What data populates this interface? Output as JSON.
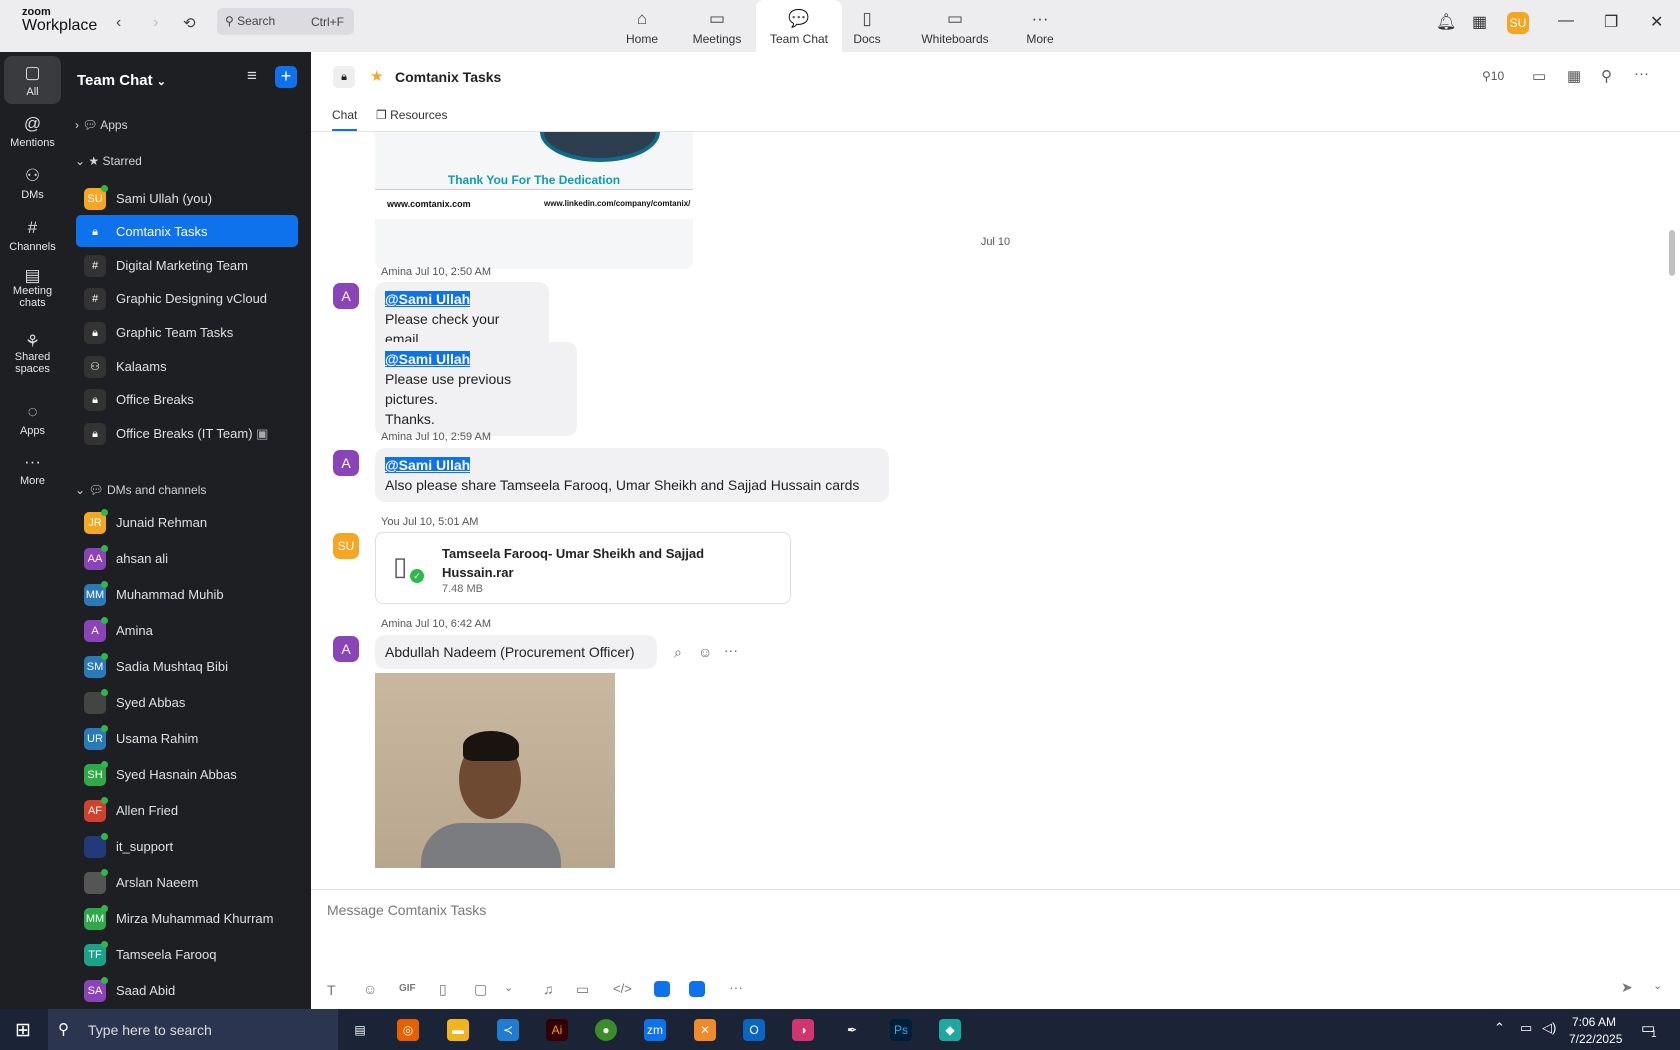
{
  "app": {
    "brand_small": "zoom",
    "brand_name": "Workplace"
  },
  "search": {
    "placeholder": "Search",
    "shortcut": "Ctrl+F"
  },
  "top_tabs": [
    {
      "label": "Home"
    },
    {
      "label": "Meetings"
    },
    {
      "label": "Team Chat"
    },
    {
      "label": "Docs"
    },
    {
      "label": "Whiteboards"
    },
    {
      "label": "More"
    }
  ],
  "user_avatar": "SU",
  "rail": [
    {
      "label": "All"
    },
    {
      "label": "Mentions"
    },
    {
      "label": "DMs"
    },
    {
      "label": "Channels"
    },
    {
      "label": "Meeting chats"
    },
    {
      "label": "Shared spaces"
    },
    {
      "label": "Apps"
    },
    {
      "label": "More"
    }
  ],
  "sidebar": {
    "title": "Team Chat",
    "apps_label": "Apps",
    "starred_label": "Starred",
    "starred": [
      {
        "initials": "SU",
        "name": "Sami Ullah (you)"
      },
      {
        "initials": "",
        "name": "Comtanix Tasks"
      },
      {
        "initials": "#",
        "name": "Digital Marketing Team"
      },
      {
        "initials": "#",
        "name": "Graphic Designing vCloud"
      },
      {
        "initials": "",
        "name": "Graphic Team Tasks"
      },
      {
        "initials": "",
        "name": "Kalaams"
      },
      {
        "initials": "",
        "name": "Office Breaks"
      },
      {
        "initials": "",
        "name": "Office Breaks (IT Team)"
      }
    ],
    "dms_label": "DMs and channels",
    "dms": [
      {
        "initials": "JR",
        "name": "Junaid Rehman",
        "color": "#f5a623"
      },
      {
        "initials": "AA",
        "name": "ahsan ali",
        "color": "#8a44b7"
      },
      {
        "initials": "MM",
        "name": "Muhammad Muhib",
        "color": "#2a7ab8"
      },
      {
        "initials": "A",
        "name": "Amina",
        "color": "#8a44b7"
      },
      {
        "initials": "SM",
        "name": "Sadia Mushtaq Bibi",
        "color": "#2a7ab8"
      },
      {
        "initials": "",
        "name": "Syed Abbas",
        "color": "#444"
      },
      {
        "initials": "UR",
        "name": "Usama Rahim",
        "color": "#2a7ab8"
      },
      {
        "initials": "SH",
        "name": "Syed Hasnain Abbas",
        "color": "#2fa84a"
      },
      {
        "initials": "AF",
        "name": "Allen Fried",
        "color": "#d0412e"
      },
      {
        "initials": "",
        "name": "it_support",
        "color": "#233a7a"
      },
      {
        "initials": "",
        "name": "Arslan Naeem",
        "color": "#555"
      },
      {
        "initials": "MM",
        "name": "Mirza Muhammad Khurram",
        "color": "#2fa84a"
      },
      {
        "initials": "TF",
        "name": "Tamseela Farooq",
        "color": "#1aa38a"
      },
      {
        "initials": "SA",
        "name": "Saad Abid",
        "color": "#8a44b7"
      }
    ]
  },
  "channel": {
    "title": "Comtanix Tasks",
    "member_count": "10",
    "tabs": [
      "Chat",
      "Resources"
    ]
  },
  "banner": {
    "text": "Thank You For The Dedication",
    "site": "www.comtanix.com",
    "linkedin": "www.linkedin.com/company/comtanix/"
  },
  "date_divider": "Jul 10",
  "messages": [
    {
      "avatar": "A",
      "meta": "Amina Jul 10, 2:50 AM",
      "mention": "@Sami Ullah",
      "text": "Please check your email."
    },
    {
      "mention": "@Sami Ullah",
      "text": "Please use previous pictures.",
      "text2": "Thanks."
    },
    {
      "avatar": "A",
      "meta": "Amina Jul 10, 2:59 AM",
      "mention": "@Sami Ullah",
      "text": "Also please share Tamseela Farooq, Umar Sheikh and Sajjad Hussain cards"
    },
    {
      "avatar": "SU",
      "meta": "You Jul 10, 5:01 AM",
      "file_name": "Tamseela Farooq- Umar Sheikh and Sajjad Hussain.rar",
      "file_size": "7.48 MB"
    },
    {
      "avatar": "A",
      "meta": "Amina Jul 10, 6:42 AM",
      "text": "Abdullah Nadeem (Procurement Officer)"
    }
  ],
  "composer": {
    "placeholder": "Message Comtanix Tasks",
    "gif": "GIF"
  },
  "taskbar": {
    "search_placeholder": "Type here to search",
    "time": "7:06 AM",
    "date": "7/22/2025",
    "notifications": "1"
  }
}
